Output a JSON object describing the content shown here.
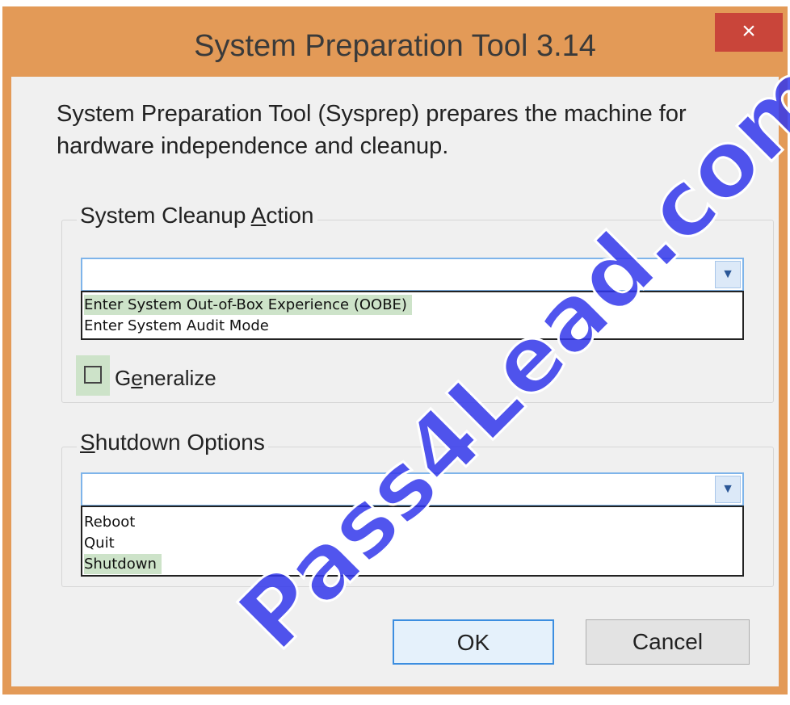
{
  "window": {
    "title": "System Preparation Tool 3.14",
    "close_glyph": "×"
  },
  "description": "System Preparation Tool (Sysprep) prepares the machine for hardware independence and cleanup.",
  "cleanup_group": {
    "legend_before": "System Cleanup ",
    "legend_accel": "A",
    "legend_after": "ction",
    "selected_value": "",
    "options": [
      "Enter System Out-of-Box Experience (OOBE)",
      "Enter System Audit Mode"
    ],
    "highlighted_option": "Enter System Out-of-Box Experience (OOBE)"
  },
  "generalize": {
    "label_before": "G",
    "label_accel": "e",
    "label_after": "neralize",
    "checked": false
  },
  "shutdown_group": {
    "legend_accel": "S",
    "legend_after": "hutdown Options",
    "selected_value": "",
    "options": [
      "Reboot",
      "Quit",
      "Shutdown"
    ],
    "highlighted_option": "Shutdown"
  },
  "buttons": {
    "ok_label": "OK",
    "cancel_label": "Cancel"
  },
  "watermark": "Pass4Lead.com",
  "colors": {
    "frame": "#e39a57",
    "close": "#c9453a",
    "highlight": "#cde3c9",
    "focus_border": "#7eb4ea",
    "watermark": "#3237eb"
  },
  "icons": {
    "close": "close-icon",
    "dropdown_arrow": "chevron-down-icon"
  }
}
